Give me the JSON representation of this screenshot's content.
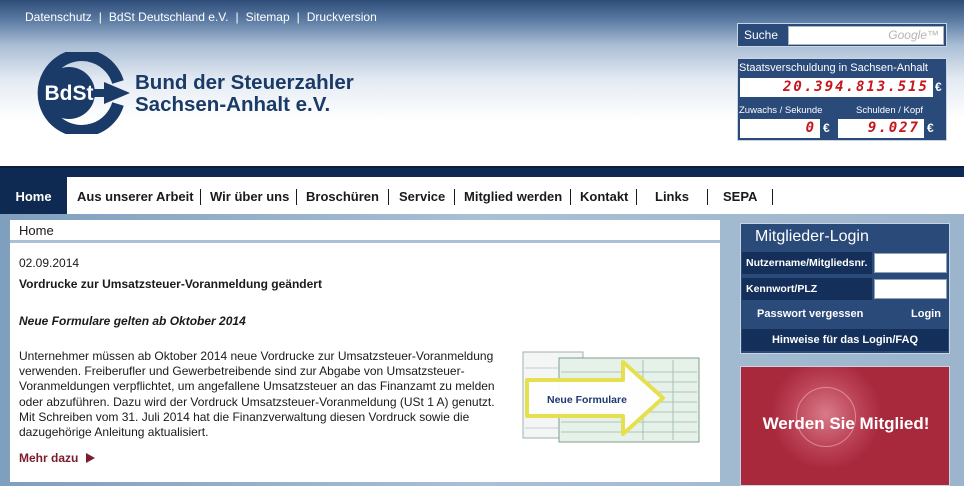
{
  "top_links": [
    "Datenschutz",
    "BdSt Deutschland e.V.",
    "Sitemap",
    "Druckversion"
  ],
  "top_links_separator": "|",
  "logo": {
    "text": "BdSt",
    "line1": "Bund der Steuerzahler",
    "line2": "Sachsen-Anhalt e.V."
  },
  "search": {
    "label": "Suche",
    "placeholder": "Google™"
  },
  "debt_clock": {
    "title": "Staatsverschuldung in Sachsen-Anhalt",
    "total": "20.394.813.515",
    "currency": "€",
    "increase_label": "Zuwachs / Sekunde",
    "increase_value": "0",
    "per_capita_label": "Schulden / Kopf",
    "per_capita_value": "9.027"
  },
  "nav": {
    "home": "Home",
    "items": [
      "Aus unserer Arbeit",
      "Wir über uns",
      "Broschüren",
      "Service",
      "Mitglied werden",
      "Kontakt",
      "Links",
      "SEPA"
    ]
  },
  "breadcrumb": "Home",
  "article": {
    "date": "02.09.2014",
    "headline": "Vordrucke zur Umsatzsteuer-Voranmeldung geändert",
    "subhead": "Neue Formulare gelten ab Oktober 2014",
    "body": "Unternehmer müssen ab Oktober 2014 neue Vordrucke zur Umsatzsteuer-Voranmeldung verwenden. Freiberufler und Gewerbetreibende sind zur Abgabe von Umsatzsteuer-Voranmeldungen verpflichtet, um angefallene Umsatzsteuer an das Finanzamt zu melden oder abzuführen. Dazu wird der Vordruck Umsatzsteuer-Voranmeldung (USt 1 A) genutzt. Mit Schreiben vom 31. Juli 2014 hat die Finanzverwaltung diesen Vordruck sowie die dazugehörige Anleitung aktualisiert.",
    "more": "Mehr dazu",
    "image_caption": "Neue Formulare"
  },
  "login": {
    "title": "Mitglieder-Login",
    "username_label": "Nutzername/Mitgliedsnr.",
    "password_label": "Kennwort/PLZ",
    "forgot": "Passwort vergessen",
    "submit": "Login",
    "faq": "Hinweise für das Login/FAQ"
  },
  "member_banner": "Werden Sie Mitglied!",
  "colors": {
    "navy": "#0f2a52",
    "panel": "#2a4a7a",
    "accent_red": "#a8283c",
    "digits": "#c4161c"
  }
}
